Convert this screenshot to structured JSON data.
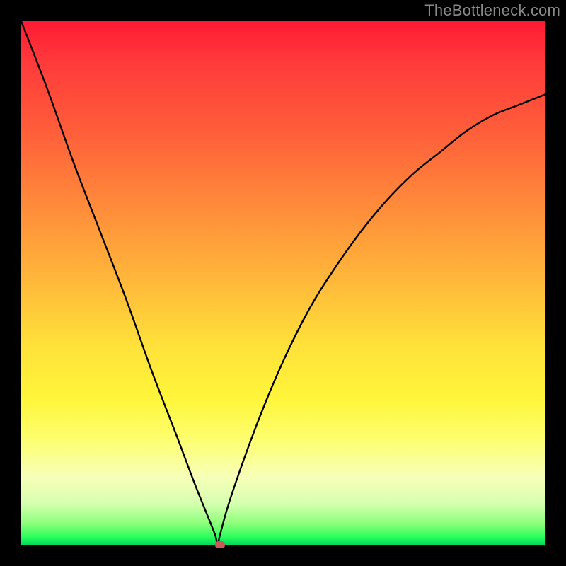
{
  "watermark": "TheBottleneck.com",
  "chart_data": {
    "type": "line",
    "title": "",
    "xlabel": "",
    "ylabel": "",
    "xlim": [
      0,
      100
    ],
    "ylim": [
      0,
      100
    ],
    "x": [
      0,
      5,
      10,
      15,
      20,
      25,
      30,
      33,
      35,
      37,
      37.5,
      38,
      40,
      45,
      50,
      55,
      60,
      65,
      70,
      75,
      80,
      85,
      90,
      95,
      100
    ],
    "y": [
      100,
      87,
      73,
      60,
      47,
      33,
      20,
      12,
      7,
      2,
      0,
      2,
      9,
      23,
      35,
      45,
      53,
      60,
      66,
      71,
      75,
      79,
      82,
      84,
      86
    ],
    "series": [
      {
        "name": "bottleneck-curve",
        "color": "#000000"
      }
    ],
    "marker": {
      "x": 38,
      "y": 0,
      "color": "#c85a5a"
    },
    "gradient_stops": [
      {
        "pos": 0,
        "color": "#ff1a33"
      },
      {
        "pos": 0.5,
        "color": "#ffe13a"
      },
      {
        "pos": 0.85,
        "color": "#fdff70"
      },
      {
        "pos": 1.0,
        "color": "#00d85c"
      }
    ]
  }
}
